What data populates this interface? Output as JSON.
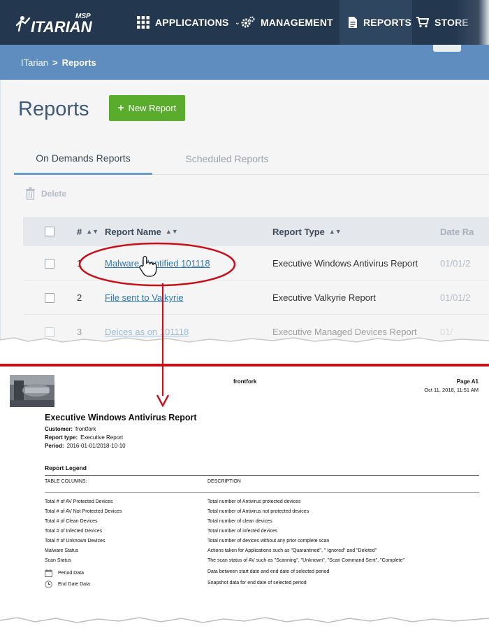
{
  "app": {
    "logo": {
      "msp": "MSP",
      "wordmark": "ITARIAN",
      "icon": "itarian-runner-icon"
    },
    "nav": {
      "applications": "APPLICATIONS",
      "management": "MANAGEMENT",
      "reports": "REPORTS",
      "store": "STORE"
    },
    "breadcrumb": {
      "root": "ITarian",
      "separator": ">",
      "current": "Reports"
    },
    "page_title": "Reports",
    "new_report_label": "New Report",
    "tabs": [
      {
        "label": "On Demands Reports",
        "active": true
      },
      {
        "label": "Scheduled Reports",
        "active": false
      }
    ],
    "delete_label": "Delete",
    "table": {
      "columns": [
        "#",
        "Report Name",
        "Report Type",
        "Date Ra"
      ],
      "rows": [
        {
          "num": "1",
          "name": "Malware Identified 101118",
          "type": "Executive Windows Antivirus Report",
          "date": "01/01/2"
        },
        {
          "num": "2",
          "name": "File sent to Valkyrie",
          "type": "Executive Valkyrie Report",
          "date": "01/01/2"
        },
        {
          "num": "3",
          "name": "Deices as on 101118",
          "type": "Executive Managed Devices Report",
          "date": "01/"
        }
      ]
    },
    "colors": {
      "nav": "#23374f",
      "breadcrumb": "#5f8dbf",
      "accent_green": "#5aac2c",
      "link": "#2b78b8",
      "annotation": "#c8101a"
    }
  },
  "report": {
    "customer_header": "frontfork",
    "page": "Page A1",
    "date": "Oct 11, 2018, 11:51 AM",
    "title": "Executive Windows Antivirus Report",
    "meta": [
      {
        "label": "Customer:",
        "value": "frontfork"
      },
      {
        "label": "Report type:",
        "value": "Executive Report"
      },
      {
        "label": "Period:",
        "value": "2016-01-01/2018-10-10"
      }
    ],
    "legend_title": "Report Legend",
    "col_headers": {
      "columns": "TABLE COLUMNS:",
      "description": "DESCRIPTION"
    },
    "legend_rows": [
      {
        "name": "Total # of AV Protected Devices",
        "desc": "Total number of Antivirus protected devices"
      },
      {
        "name": "Total # of AV Not Protected Devices",
        "desc": "Total number of Antivirus not protected devices"
      },
      {
        "name": "Total # of Clean Devices",
        "desc": "Total number of clean devices"
      },
      {
        "name": "Total # of Infected Devices",
        "desc": "Total number of infected devices"
      },
      {
        "name": "Total # of Unknown Devices",
        "desc": "Total number of devices without any prior complete scan"
      },
      {
        "name": "Malware Status",
        "desc": "Actions taken for Applications such as \"Quarantined\", \" Ignored\" and \"Deleted\""
      },
      {
        "name": "Scan Status",
        "desc": "The scan status of AV such as \"Scanning\", \"Unknown\",  \"Scan Command Sent\", \"Complete\""
      },
      {
        "name": "Period Data",
        "desc": "Data between start date and end date of selected period",
        "icon": "calendar-icon"
      },
      {
        "name": "End Date Data",
        "desc": "Snapshot data for end date of selected period",
        "icon": "clock-icon"
      }
    ]
  }
}
